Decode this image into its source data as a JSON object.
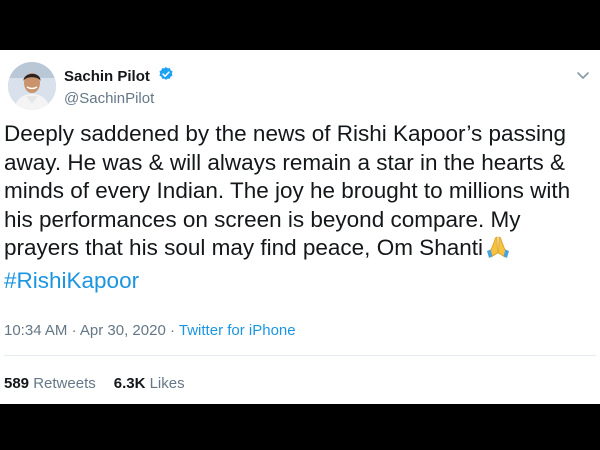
{
  "tweet": {
    "author": {
      "display_name": "Sachin Pilot",
      "handle": "@SachinPilot",
      "verified": true
    },
    "text": "Deeply saddened by the news of Rishi Kapoor’s passing away. He was & will always remain a star in the hearts & minds of every Indian. The joy he brought to millions with his performances on screen is beyond compare. My prayers that his soul may find peace, Om Shanti",
    "hashtag": "#RishiKapoor",
    "time": "10:34 AM",
    "date": "Apr 30, 2020",
    "separator": "·",
    "source": "Twitter for iPhone",
    "retweets_count": "589",
    "retweets_label": "Retweets",
    "likes_count": "6.3K",
    "likes_label": "Likes"
  },
  "colors": {
    "link": "#1b95e0",
    "text": "#14171a",
    "muted": "#657786"
  },
  "icons": {
    "verified": "verified-badge-icon",
    "menu": "chevron-down-icon",
    "emoji": "folded-hands-icon"
  }
}
